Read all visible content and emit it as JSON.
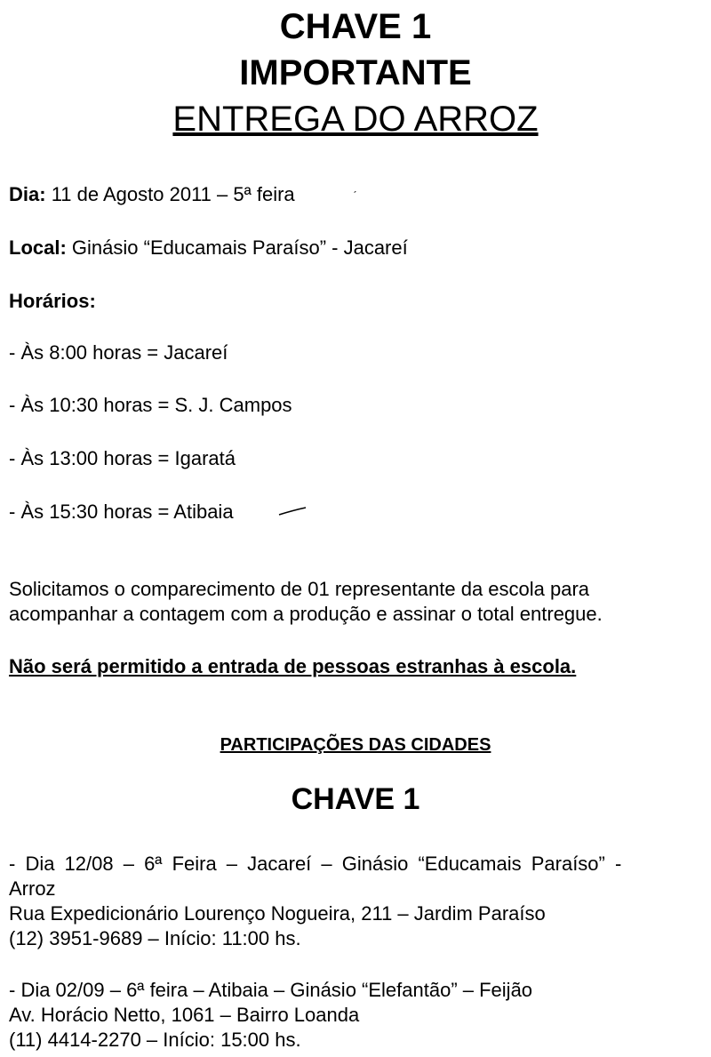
{
  "header": {
    "line1": "CHAVE 1",
    "line2": "IMPORTANTE",
    "line3": "ENTREGA DO ARROZ"
  },
  "info": {
    "dia_label": "Dia:",
    "dia_value": "11 de Agosto 2011 – 5ª feira",
    "local_label": "Local:",
    "local_value": "Ginásio “Educamais Paraíso” - Jacareí",
    "horarios_label": "Horários:"
  },
  "horarios": [
    "- Às 8:00 horas = Jacareí",
    "- Às 10:30 horas = S. J. Campos",
    "- Às 13:00 horas = Igaratá",
    "- Às 15:30 horas = Atibaia"
  ],
  "notice": {
    "line1": "Solicitamos o comparecimento de 01 representante da escola para",
    "line2": "acompanhar a contagem com a produção e assinar o total entregue.",
    "warning": "Não será permitido a entrada de pessoas estranhas à escola."
  },
  "participacoes": {
    "title": "PARTICIPAÇÕES DAS CIDADES",
    "subtitle": "CHAVE 1",
    "entries": [
      {
        "line1": "- Dia 12/08 – 6ª Feira – Jacareí – Ginásio “Educamais Paraíso” -",
        "line2": "Arroz",
        "line3": "Rua Expedicionário Lourenço Nogueira, 211 – Jardim Paraíso",
        "line4": "(12) 3951-9689 – Início: 11:00 hs."
      },
      {
        "line1": "- Dia 02/09 – 6ª feira – Atibaia – Ginásio “Elefantão” – Feijão",
        "line2": "Av. Horácio Netto, 1061 – Bairro Loanda",
        "line3": "(11) 4414-2270 – Início: 15:00 hs."
      }
    ]
  }
}
